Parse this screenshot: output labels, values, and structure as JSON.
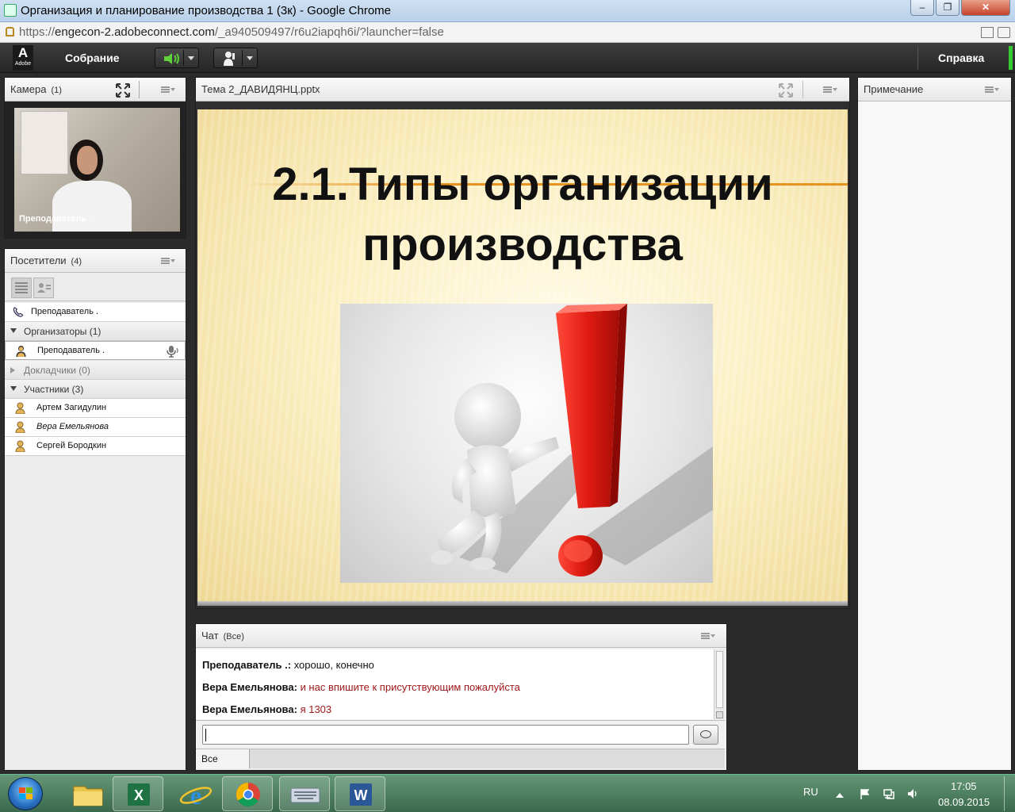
{
  "browser": {
    "window_title": "Организация и планирование производства 1 (3к) - Google Chrome",
    "url_prefix": "https://",
    "url_host": "engecon-2.adobeconnect.com",
    "url_path": "/_a940509497/r6u2iapqh6i/?launcher=false",
    "min_label": "–",
    "max_label": "❐",
    "close_label": "✕"
  },
  "menubar": {
    "logo_letter": "A",
    "logo_text": "Adobe",
    "meeting_label": "Собрание",
    "help_label": "Справка"
  },
  "camera_pod": {
    "title": "Камера",
    "count": "(1)",
    "video_label": "Преподаватель ."
  },
  "attendees_pod": {
    "title": "Посетители",
    "count": "(4)",
    "top_user": "Преподаватель .",
    "sections": [
      {
        "label": "Организаторы (1)",
        "expanded": true,
        "users": [
          "Преподаватель ."
        ]
      },
      {
        "label": "Докладчики (0)",
        "expanded": false,
        "users": []
      },
      {
        "label": "Участники (3)",
        "expanded": true,
        "users": [
          "Артем Загидулин",
          "Вера Емельянова",
          "Сергей Бородкин"
        ]
      }
    ]
  },
  "share_pod": {
    "title": "Тема 2_ДАВИДЯНЦ.pptx",
    "slide_title_line1": "2.1.Типы организации",
    "slide_title_line2": "производства"
  },
  "notes_pod": {
    "title": "Примечание"
  },
  "chat_pod": {
    "title": "Чат",
    "scope": "(Все)",
    "messages": [
      {
        "sender": "Преподаватель .:",
        "text": "хорошо, конечно",
        "highlight": false
      },
      {
        "sender": "Вера Емельянова:",
        "text": "и нас впишите к присутствующим пожалуйста",
        "highlight": true
      },
      {
        "sender": "Вера Емельянова:",
        "text": "я 1303",
        "highlight": true
      }
    ],
    "input_value": "",
    "tab_all": "Все"
  },
  "taskbar": {
    "language": "RU",
    "time": "17:05",
    "date": "08.09.2015"
  },
  "colors": {
    "accent_red": "#a0191b",
    "speaker_green": "#5fd13a",
    "exclamation_red": "#e01b12"
  }
}
